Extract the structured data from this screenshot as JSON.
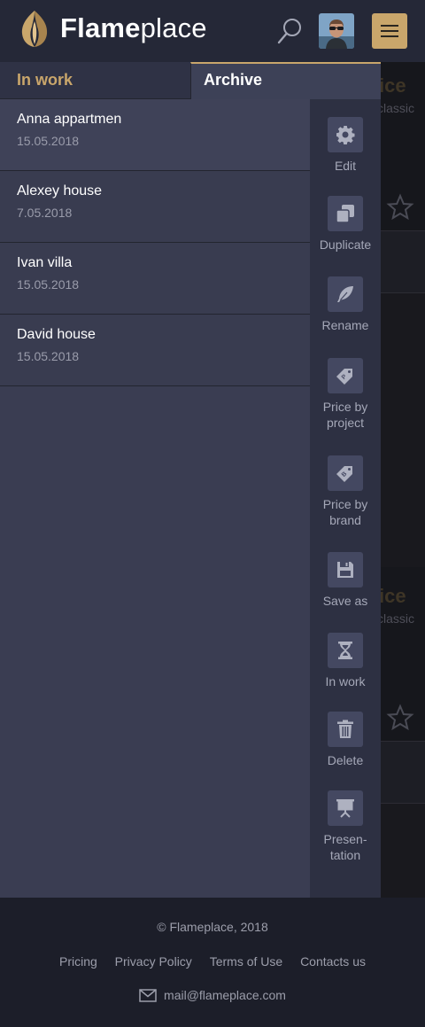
{
  "header": {
    "logo_bold": "Flame",
    "logo_light": "place"
  },
  "background": {
    "card_title": "ice",
    "card_sub": "classic"
  },
  "tabs": [
    {
      "label": "In work"
    },
    {
      "label": "Archive"
    }
  ],
  "projects": [
    {
      "name": "Anna appartmen",
      "date": "15.05.2018"
    },
    {
      "name": "Alexey house",
      "date": "7.05.2018"
    },
    {
      "name": "Ivan villa",
      "date": "15.05.2018"
    },
    {
      "name": "David house",
      "date": "15.05.2018"
    }
  ],
  "actions": [
    {
      "label": "Edit",
      "icon": "gear-icon"
    },
    {
      "label": "Duplicate",
      "icon": "duplicate-icon"
    },
    {
      "label": "Rename",
      "icon": "feather-icon"
    },
    {
      "label": "Price by project",
      "line1": "Price by",
      "line2": "project",
      "icon": "price-tag-p-icon"
    },
    {
      "label": "Price by brand",
      "line1": "Price by",
      "line2": "brand",
      "icon": "price-tag-b-icon"
    },
    {
      "label": "Save as",
      "icon": "floppy-icon"
    },
    {
      "label": "In work",
      "icon": "hourglass-icon"
    },
    {
      "label": "Delete",
      "icon": "trash-icon"
    },
    {
      "label": "Presentation",
      "line1": "Presen-",
      "line2": "tation",
      "icon": "presentation-icon"
    }
  ],
  "footer": {
    "copyright": "© Flameplace, 2018",
    "links": [
      "Pricing",
      "Privacy Policy",
      "Terms of Use",
      "Contacts us"
    ],
    "email": "mail@flameplace.com"
  },
  "colors": {
    "accent": "#c9a66b",
    "header_bg": "#252837",
    "drawer_bg": "#3a3d52",
    "footer_bg": "#1c1e29"
  }
}
